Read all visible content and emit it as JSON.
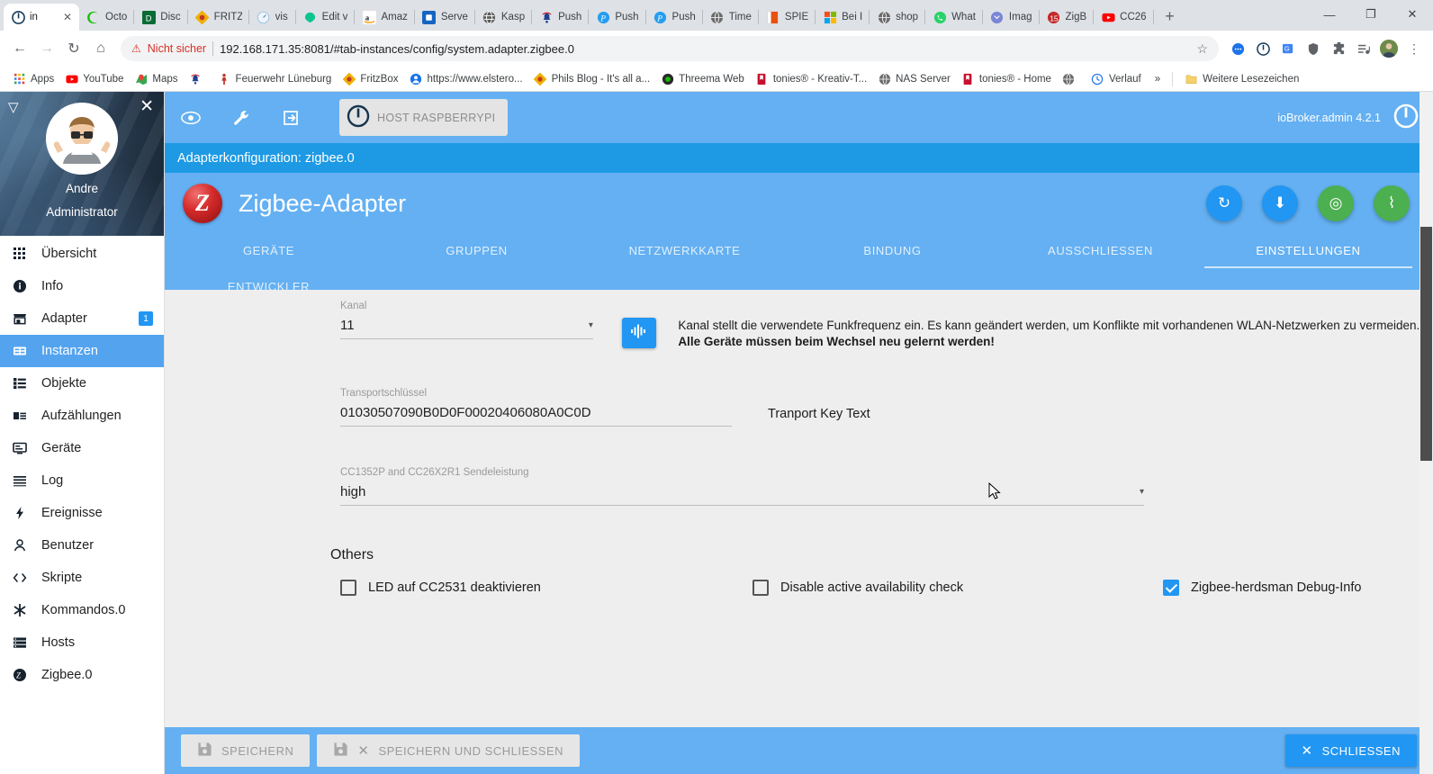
{
  "browser": {
    "tabs": [
      {
        "title": "in",
        "icon": "iobroker-icon",
        "active": true
      },
      {
        "title": "Octo",
        "icon": "octoprint-icon",
        "active": false
      },
      {
        "title": "Disc",
        "icon": "discourse-icon",
        "active": false
      },
      {
        "title": "FRITZ",
        "icon": "fritzbox-icon",
        "active": false
      },
      {
        "title": "vis",
        "icon": "vis-icon",
        "active": false
      },
      {
        "title": "Edit v",
        "icon": "editor-icon",
        "active": false
      },
      {
        "title": "Amaz",
        "icon": "amazon-icon",
        "active": false
      },
      {
        "title": "Serve",
        "icon": "server-icon",
        "active": false
      },
      {
        "title": "Kasp",
        "icon": "kaspersky-icon",
        "active": false
      },
      {
        "title": "Push",
        "icon": "pushbell-icon",
        "active": false
      },
      {
        "title": "Push",
        "icon": "pushover-icon",
        "active": false
      },
      {
        "title": "Push",
        "icon": "pushover-icon",
        "active": false
      },
      {
        "title": "Time",
        "icon": "globe-icon",
        "active": false
      },
      {
        "title": "SPIE",
        "icon": "spiegel-icon",
        "active": false
      },
      {
        "title": "Bei I",
        "icon": "microsoft-icon",
        "active": false
      },
      {
        "title": "shop",
        "icon": "globe-icon",
        "active": false
      },
      {
        "title": "What",
        "icon": "whatsapp-icon",
        "active": false
      },
      {
        "title": "Imag",
        "icon": "image-icon",
        "active": false
      },
      {
        "title": "ZigB",
        "icon": "zigbee2mqtt-icon",
        "active": false
      },
      {
        "title": "CC26",
        "icon": "youtube-icon",
        "active": false
      }
    ],
    "new_tab_label": "+",
    "window_controls": {
      "minimize": "—",
      "restore": "❐",
      "close": "✕"
    },
    "nav": {
      "back": "←",
      "forward": "→",
      "reload": "↻",
      "home": "⌂"
    },
    "omnibox": {
      "security_label": "Nicht sicher",
      "url": "192.168.171.35:8081/#tab-instances/config/system.adapter.zigbee.0",
      "star_icon": "☆"
    },
    "toolbar_icons": [
      "chat-icon",
      "iobroker-icon",
      "translate-icon",
      "shield-icon",
      "extensions-icon",
      "playlist-icon",
      "profile-avatar",
      "menu-icon"
    ],
    "bookmarks": [
      {
        "label": "Apps",
        "icon": "apps-grid-icon"
      },
      {
        "label": "YouTube",
        "icon": "youtube-icon"
      },
      {
        "label": "Maps",
        "icon": "maps-icon"
      },
      {
        "label": "",
        "icon": "pushbell-icon"
      },
      {
        "label": "Feuerwehr Lüneburg",
        "icon": "firefighter-icon"
      },
      {
        "label": "FritzBox",
        "icon": "fritzbox-icon"
      },
      {
        "label": "https://www.elstero...",
        "icon": "person-blue-icon"
      },
      {
        "label": "Phils Blog - It's all a...",
        "icon": "fritzbox-icon"
      },
      {
        "label": "Threema Web",
        "icon": "threema-icon"
      },
      {
        "label": "tonies® - Kreativ-T...",
        "icon": "tonies-icon"
      },
      {
        "label": "NAS Server",
        "icon": "globe-icon"
      },
      {
        "label": "tonies® - Home",
        "icon": "tonies-icon"
      },
      {
        "label": "",
        "icon": "globe-icon"
      },
      {
        "label": "Verlauf",
        "icon": "history-icon"
      }
    ],
    "bookmarks_overflow": "»",
    "other_bookmarks": {
      "label": "Weitere Lesezeichen",
      "icon": "folder-icon"
    }
  },
  "sidebar": {
    "caret_icon": "▽",
    "close_icon": "✕",
    "user_name": "Andre",
    "user_role": "Administrator",
    "items": [
      {
        "label": "Übersicht",
        "icon": "grid-icon",
        "badge": "",
        "active": false
      },
      {
        "label": "Info",
        "icon": "info-icon",
        "badge": "",
        "active": false
      },
      {
        "label": "Adapter",
        "icon": "store-icon",
        "badge": "1",
        "active": false
      },
      {
        "label": "Instanzen",
        "icon": "instances-icon",
        "badge": "",
        "active": true
      },
      {
        "label": "Objekte",
        "icon": "list-icon",
        "badge": "",
        "active": false
      },
      {
        "label": "Aufzählungen",
        "icon": "enum-icon",
        "badge": "",
        "active": false
      },
      {
        "label": "Geräte",
        "icon": "device-icon",
        "badge": "",
        "active": false
      },
      {
        "label": "Log",
        "icon": "log-icon",
        "badge": "",
        "active": false
      },
      {
        "label": "Ereignisse",
        "icon": "bolt-icon",
        "badge": "",
        "active": false
      },
      {
        "label": "Benutzer",
        "icon": "user-icon",
        "badge": "",
        "active": false
      },
      {
        "label": "Skripte",
        "icon": "code-icon",
        "badge": "",
        "active": false
      },
      {
        "label": "Kommandos.0",
        "icon": "asterisk-icon",
        "badge": "",
        "active": false
      },
      {
        "label": "Hosts",
        "icon": "hosts-icon",
        "badge": "",
        "active": false
      },
      {
        "label": "Zigbee.0",
        "icon": "zigbee-icon",
        "badge": "",
        "active": false
      }
    ]
  },
  "apptop": {
    "icons": [
      "eye-icon",
      "wrench-icon",
      "login-icon"
    ],
    "host_chip": {
      "label": "HOST RASPBERRYPI",
      "icon": "power-icon"
    },
    "version": "ioBroker.admin 4.2.1",
    "logo_icon": "iobroker-icon"
  },
  "config": {
    "bar_title": "Adapterkonfiguration: zigbee.0",
    "adapter_title": "Zigbee-Adapter",
    "adapter_logo": "Z",
    "head_buttons": [
      {
        "name": "refresh-button",
        "icon": "↻",
        "color": "blue"
      },
      {
        "name": "backup-button",
        "icon": "⬇",
        "color": "blue"
      },
      {
        "name": "pairing-button",
        "icon": "◎",
        "color": "green"
      },
      {
        "name": "touchlink-button",
        "icon": "⌇",
        "color": "green"
      }
    ],
    "tabs": [
      {
        "label": "GERÄTE",
        "active": false
      },
      {
        "label": "GRUPPEN",
        "active": false
      },
      {
        "label": "NETZWERKKARTE",
        "active": false
      },
      {
        "label": "BINDUNG",
        "active": false
      },
      {
        "label": "AUSSCHLIESSEN",
        "active": false
      },
      {
        "label": "EINSTELLUNGEN",
        "active": true
      },
      {
        "label": "ENTWICKLER",
        "active": false
      }
    ]
  },
  "form": {
    "kanal": {
      "label": "Kanal",
      "value": "11",
      "caret": "▾",
      "scan_button_icon": "signal-bars-icon",
      "help_text_1": "Kanal stellt die verwendete Funkfrequenz ein. Es kann geändert werden, um Konflikte mit vorhandenen WLAN-Netzwerken zu vermeiden. ",
      "help_text_bold": "Alle Geräte müssen beim Wechsel neu gelernt werden!"
    },
    "transportkey": {
      "label": "Transportschlüssel",
      "value": "01030507090B0D0F00020406080A0C0D",
      "note": "Tranport Key Text"
    },
    "power": {
      "label": "CC1352P and CC26X2R1 Sendeleistung",
      "value": "high",
      "caret": "▾"
    },
    "others_title": "Others",
    "checkboxes": [
      {
        "label": "LED auf CC2531 deaktivieren",
        "checked": false
      },
      {
        "label": "Disable active availability check",
        "checked": false
      },
      {
        "label": "Zigbee-herdsman Debug-Info",
        "checked": true
      }
    ]
  },
  "footer": {
    "save": {
      "label": "SPEICHERN",
      "icon": "save-icon"
    },
    "save_close": {
      "label": "SPEICHERN UND SCHLIESSEN",
      "icon": "save-icon",
      "icon2": "✕"
    },
    "close": {
      "label": "SCHLIESSEN",
      "icon": "✕"
    }
  },
  "colors": {
    "accent_blue": "#2196f3",
    "header_blue": "#64b0f2",
    "config_bar_blue": "#1e9ae5",
    "green": "#4caf50",
    "sidebar_active": "#54a3ef",
    "warn_red": "#d93025"
  }
}
